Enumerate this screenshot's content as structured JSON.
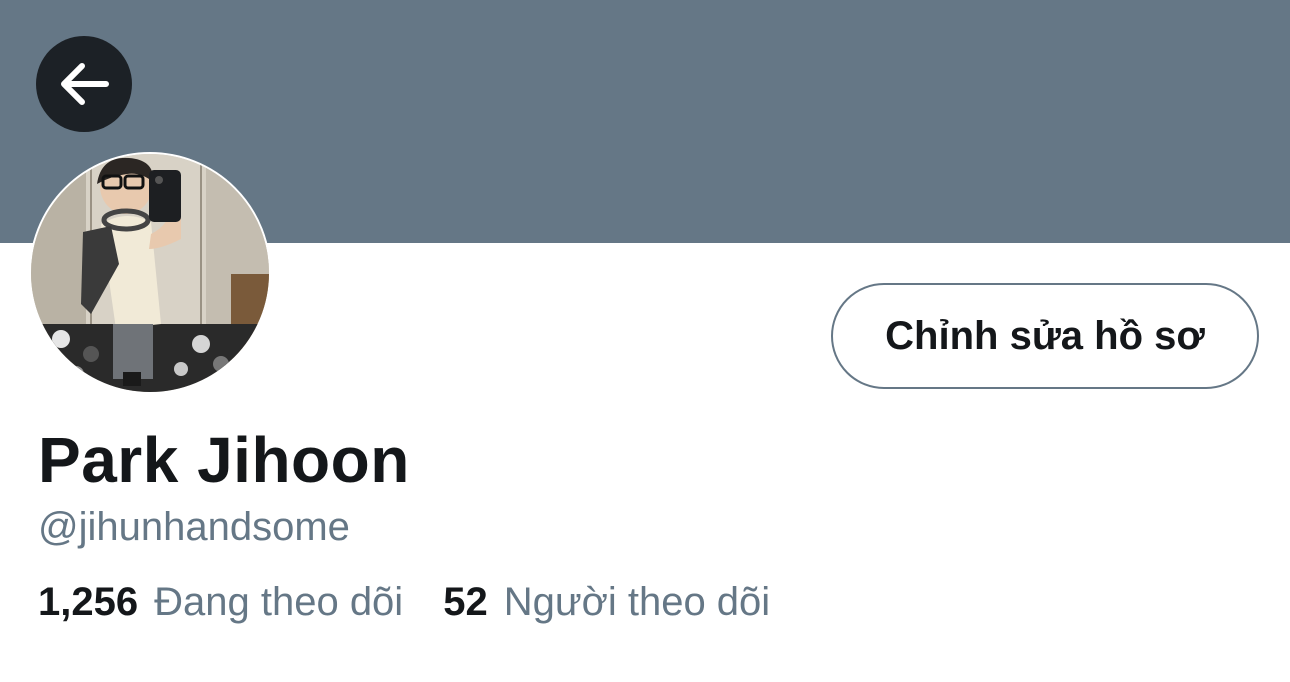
{
  "header": {
    "back_icon": "arrow-left-icon",
    "banner_color": "#657786"
  },
  "profile": {
    "display_name": "Park Jihoon",
    "handle": "@jihunhandsome",
    "edit_button_label": "Chỉnh sửa hồ sơ",
    "avatar_description_icon": "avatar-photo",
    "following": {
      "count": "1,256",
      "label": "Đang theo dõi"
    },
    "followers": {
      "count": "52",
      "label": "Người theo dõi"
    }
  },
  "colors": {
    "text_primary": "#14171a",
    "text_secondary": "#657786",
    "back_button_bg": "#1c2126"
  }
}
